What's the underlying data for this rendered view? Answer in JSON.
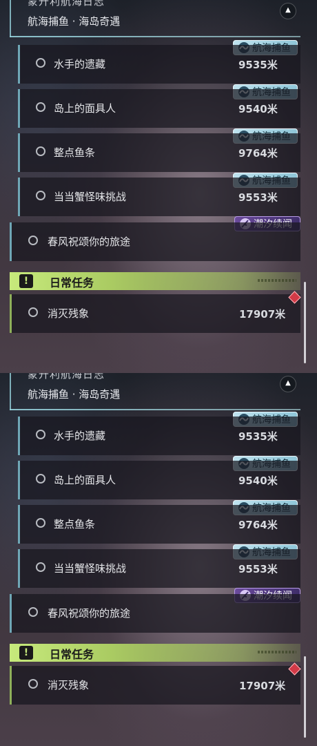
{
  "header": {
    "title_cut": "蒙升利航海日志",
    "subtitle": "航海捕鱼 · 海岛奇遇",
    "collapse_icon": "▲"
  },
  "sub_quests": [
    {
      "name": "水手的遗藏",
      "distance": "9535米",
      "tag": "航海捕鱼"
    },
    {
      "name": "岛上的面具人",
      "distance": "9540米",
      "tag": "航海捕鱼"
    },
    {
      "name": "整点鱼条",
      "distance": "9764米",
      "tag": "航海捕鱼"
    },
    {
      "name": "当当蟹怪味挑战",
      "distance": "9553米",
      "tag": "航海捕鱼"
    }
  ],
  "main_quest": {
    "name": "春风祝颂你的旅途",
    "tag": "潮汐续闻"
  },
  "daily": {
    "title": "日常任务",
    "icon": "!",
    "quest": {
      "name": "消灭残象",
      "distance": "17907米"
    }
  },
  "colors": {
    "fish_badge": "#bfe3ef",
    "tide_badge": "#6a4a9c",
    "daily_accent": "#c7ea7c",
    "sub_bar": "#6fa7b6",
    "marker": "#d23a47"
  },
  "icons": [
    "wave-icon",
    "quill-icon",
    "radio-circle-icon",
    "exclamation-icon",
    "red-diamond-marker-icon",
    "collapse-up-icon"
  ]
}
